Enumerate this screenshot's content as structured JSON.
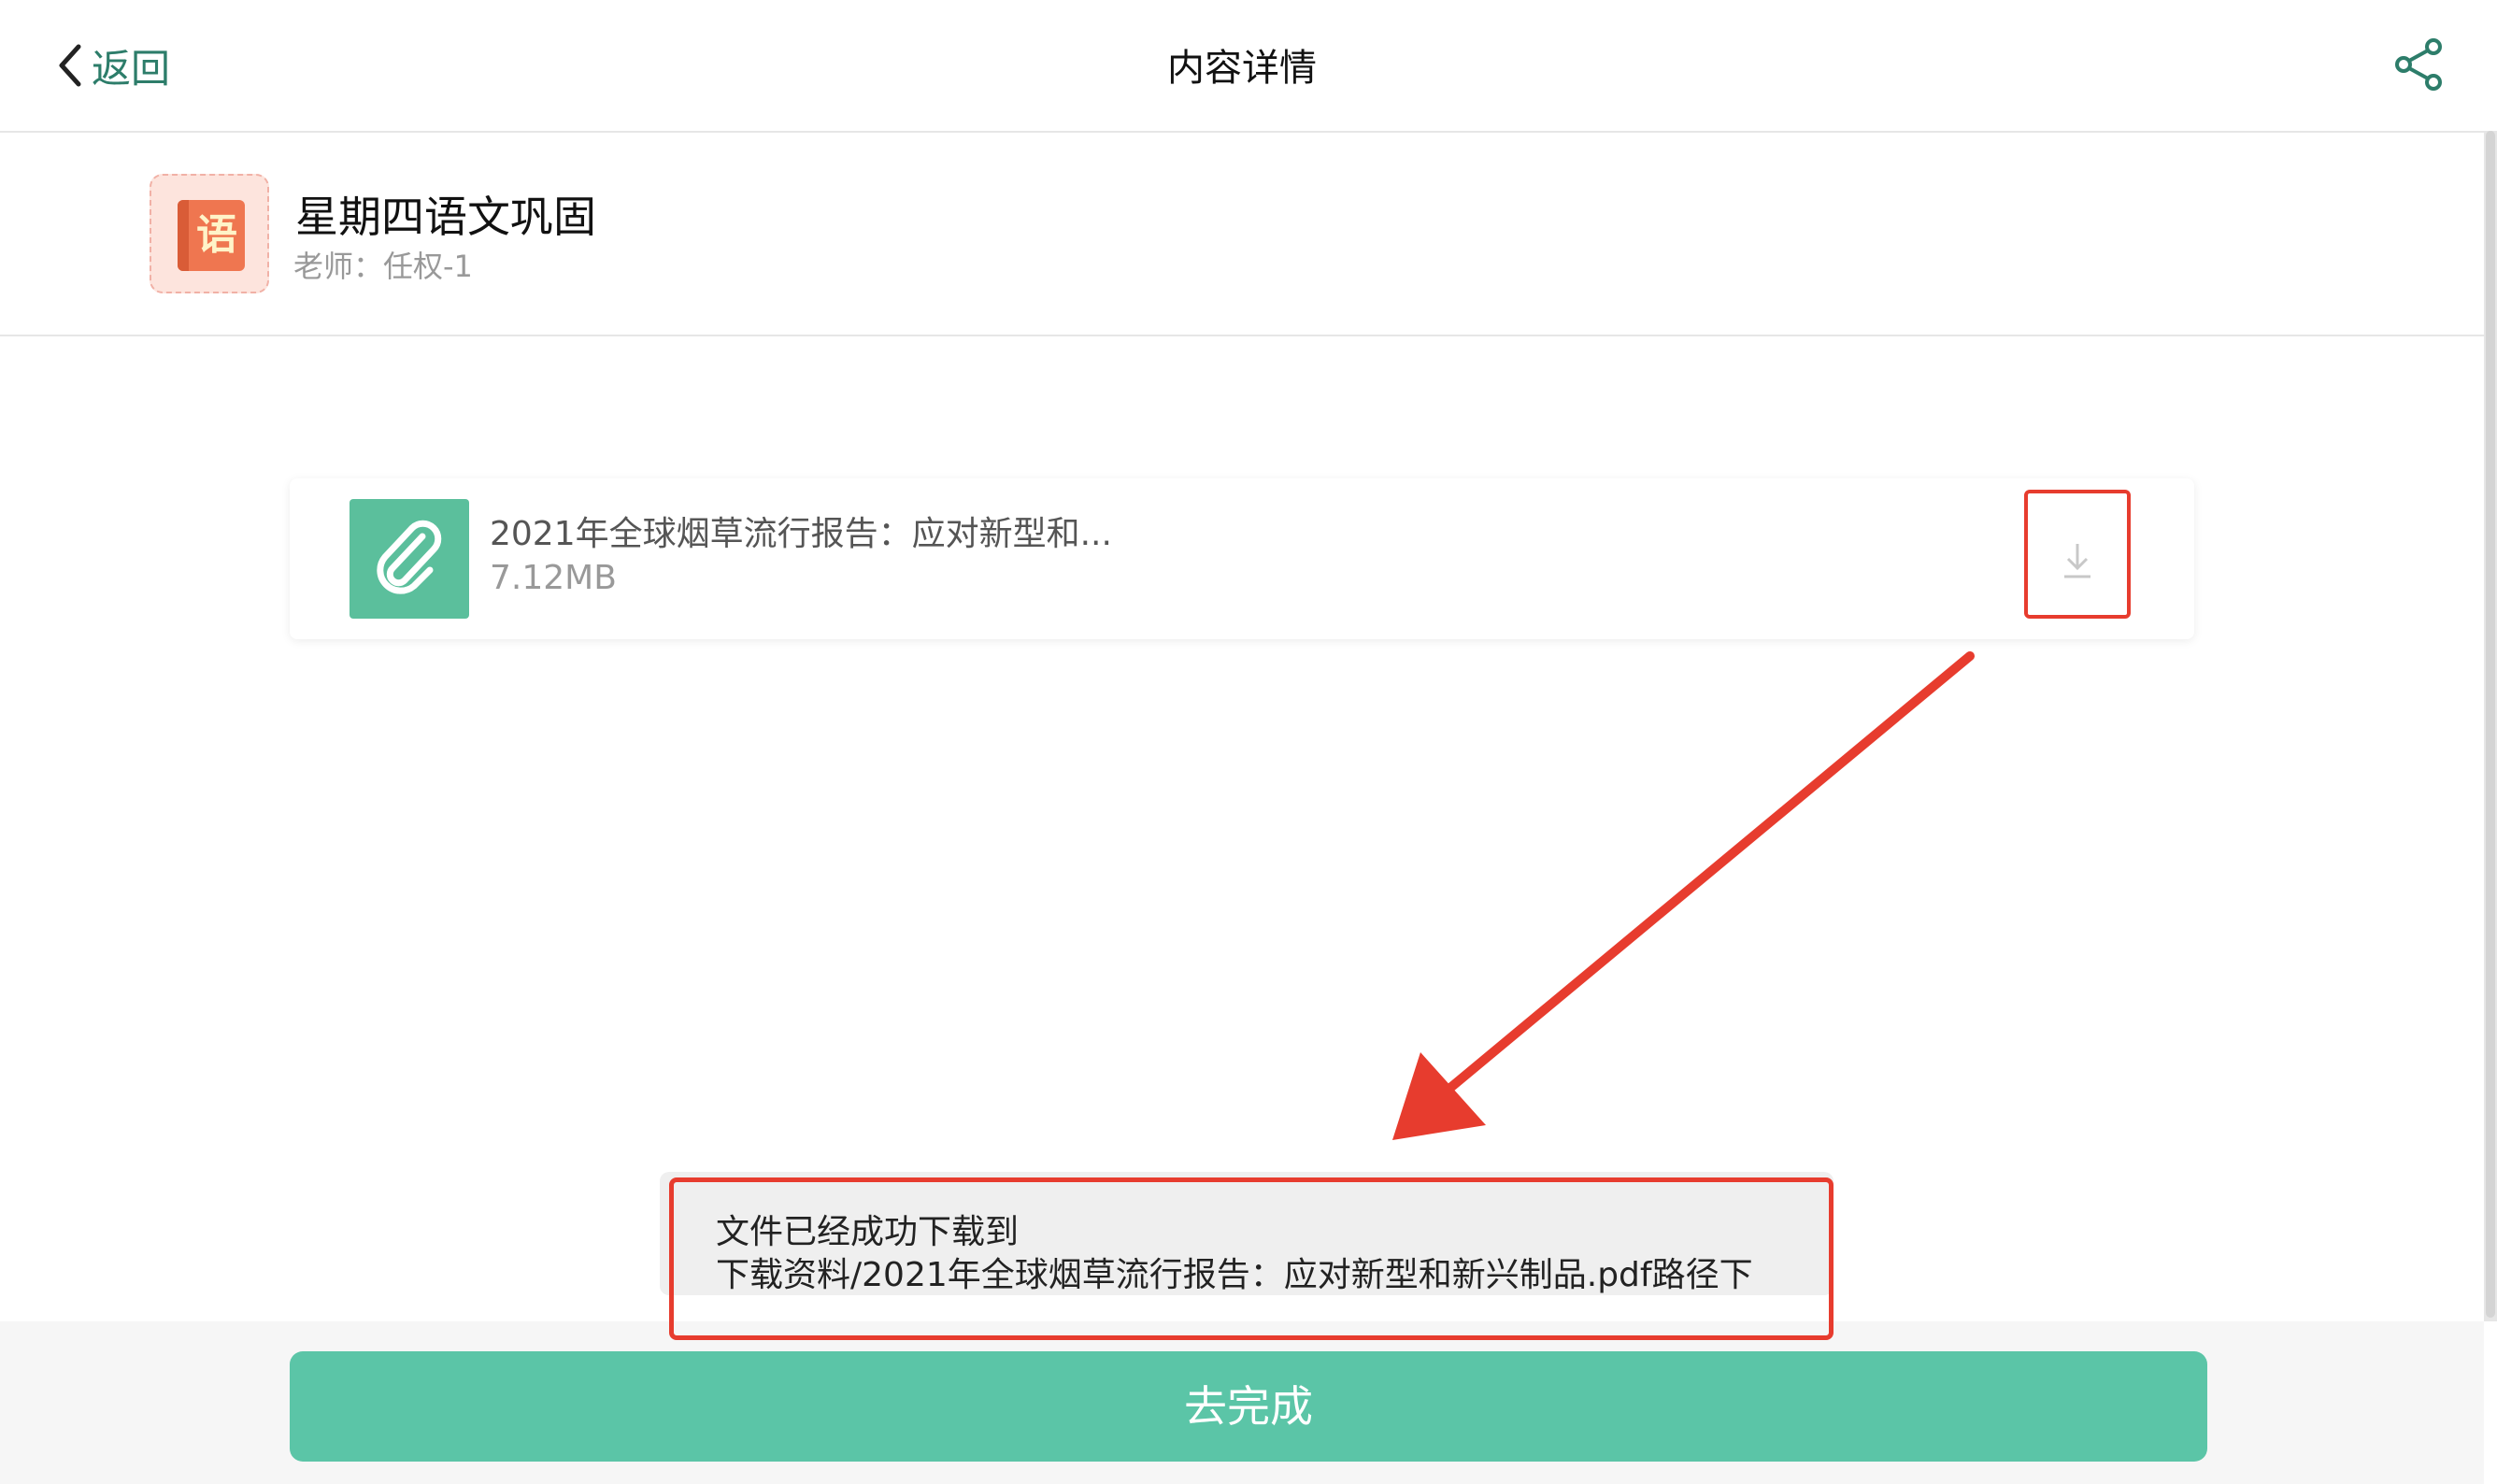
{
  "header": {
    "back_label": "返回",
    "title": "内容详情",
    "share_icon": "share-icon"
  },
  "course": {
    "icon_char": "语",
    "name": "星期四语文巩固",
    "teacher": "老师：任权-1"
  },
  "attachment": {
    "file_name": "2021年全球烟草流行报告：应对新型和...",
    "file_size": "7.12MB",
    "icon": "paperclip-icon",
    "download_icon": "download-icon"
  },
  "toast": {
    "line1": "文件已经成功下载到",
    "line2": "下载资料/2021年全球烟草流行报告：应对新型和新兴制品.pdf路径下"
  },
  "footer": {
    "done_label": "去完成"
  },
  "colors": {
    "accent": "#5bc5a7",
    "link": "#2d7d6a",
    "annotation": "#e73c2e"
  }
}
